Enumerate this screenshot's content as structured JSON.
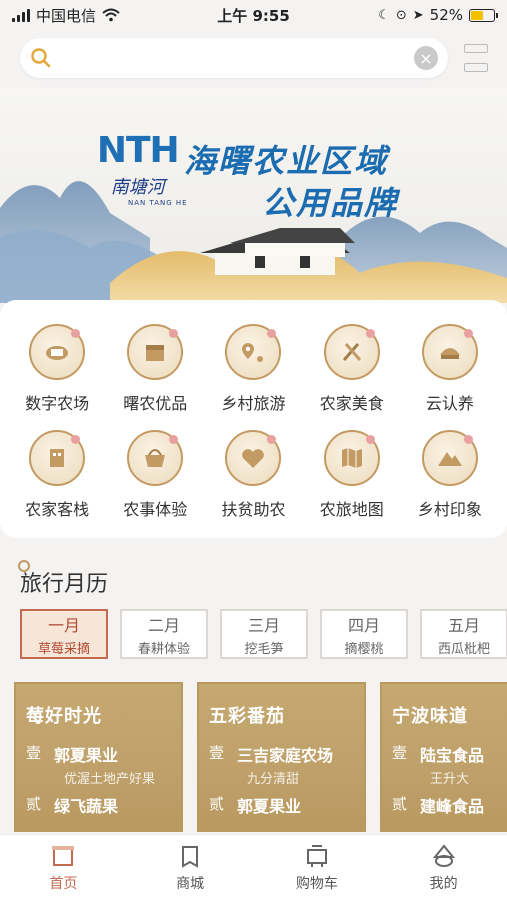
{
  "status_bar": {
    "carrier": "中国电信",
    "time": "上午 9:55",
    "battery": "52%"
  },
  "search": {
    "placeholder": ""
  },
  "banner": {
    "logo": "NTH",
    "logo_text": "南塘河",
    "logo_sub": "NAN TANG HE",
    "slogan_line1": "海曙农业区域",
    "slogan_line2": "公用品牌"
  },
  "categories": [
    {
      "label": "数字农场",
      "icon": "digital-farm-icon"
    },
    {
      "label": "曙农优品",
      "icon": "premium-goods-icon"
    },
    {
      "label": "乡村旅游",
      "icon": "rural-tour-icon"
    },
    {
      "label": "农家美食",
      "icon": "farm-food-icon"
    },
    {
      "label": "云认养",
      "icon": "cloud-adopt-icon"
    },
    {
      "label": "农家客栈",
      "icon": "inn-icon"
    },
    {
      "label": "农事体验",
      "icon": "farm-experience-icon"
    },
    {
      "label": "扶贫助农",
      "icon": "poverty-aid-icon"
    },
    {
      "label": "农旅地图",
      "icon": "map-icon"
    },
    {
      "label": "乡村印象",
      "icon": "village-impression-icon"
    }
  ],
  "travel_calendar": {
    "title": "旅行月历",
    "months": [
      {
        "month": "一月",
        "activity": "草莓采摘",
        "active": true
      },
      {
        "month": "二月",
        "activity": "春耕体验",
        "active": false
      },
      {
        "month": "三月",
        "activity": "挖毛笋",
        "active": false
      },
      {
        "month": "四月",
        "activity": "摘樱桃",
        "active": false
      },
      {
        "month": "五月",
        "activity": "西瓜枇杷",
        "active": false
      }
    ],
    "cards": [
      {
        "title": "莓好时光",
        "items": [
          {
            "num": "壹",
            "name": "郭夏果业",
            "note": "优渥土地产好果"
          },
          {
            "num": "贰",
            "name": "绿飞蔬果",
            "note": ""
          }
        ]
      },
      {
        "title": "五彩番茄",
        "items": [
          {
            "num": "壹",
            "name": "三吉家庭农场",
            "note": "九分清甜"
          },
          {
            "num": "贰",
            "name": "郭夏果业",
            "note": ""
          }
        ]
      },
      {
        "title": "宁波味道",
        "items": [
          {
            "num": "壹",
            "name": "陆宝食品",
            "note": "王升大"
          },
          {
            "num": "贰",
            "name": "建峰食品",
            "note": ""
          }
        ]
      }
    ]
  },
  "tabbar": [
    {
      "label": "首页",
      "icon": "home-icon",
      "active": true
    },
    {
      "label": "商城",
      "icon": "mall-icon",
      "active": false
    },
    {
      "label": "购物车",
      "icon": "cart-icon",
      "active": false
    },
    {
      "label": "我的",
      "icon": "profile-icon",
      "active": false
    }
  ],
  "colors": {
    "accent": "#c26b4f",
    "gold": "#c49a63",
    "brand_blue": "#1b6cb0",
    "card_gold": "#c5a870"
  }
}
